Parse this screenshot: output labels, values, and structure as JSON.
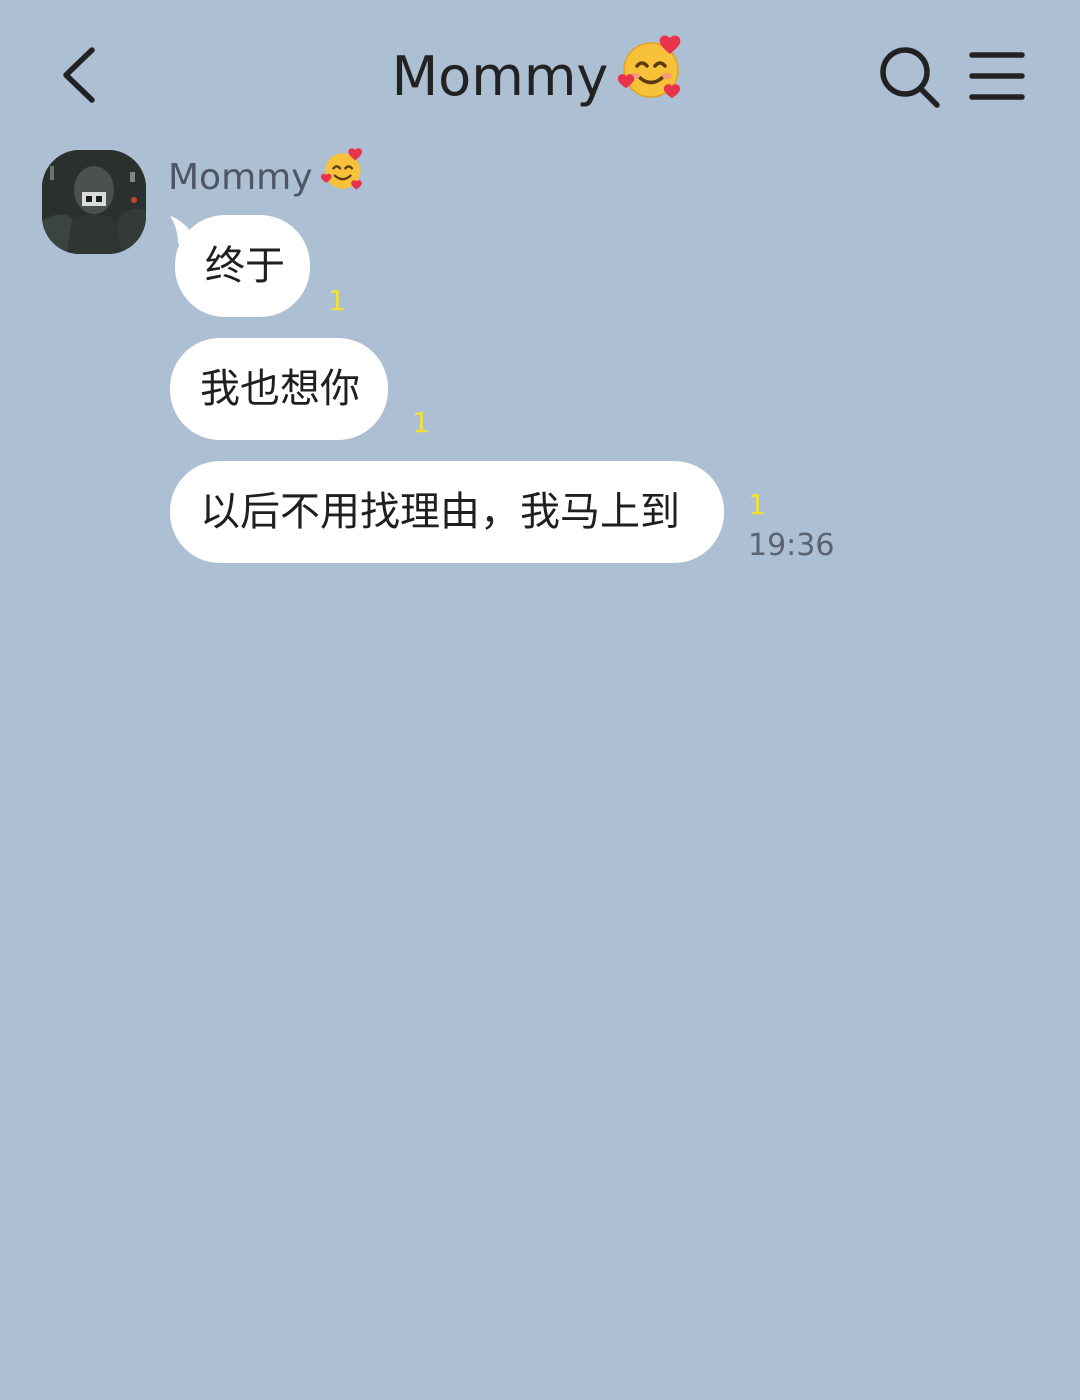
{
  "header": {
    "title": "Mommy",
    "title_emoji": "smiling-face-with-hearts",
    "back_icon": "chevron-left-icon",
    "search_icon": "search-icon",
    "menu_icon": "menu-icon"
  },
  "chat": {
    "sender_name": "Mommy",
    "sender_emoji": "smiling-face-with-hearts",
    "messages": [
      {
        "text": "终于",
        "unread": "1",
        "time": ""
      },
      {
        "text": "我也想你",
        "unread": "1",
        "time": ""
      },
      {
        "text": "以后不用找理由，我马上到",
        "unread": "1",
        "time": "19:36"
      }
    ]
  },
  "colors": {
    "background": "#acbfd3",
    "bubble": "#ffffff",
    "unread": "#f0e13a",
    "time": "#5a6470"
  }
}
